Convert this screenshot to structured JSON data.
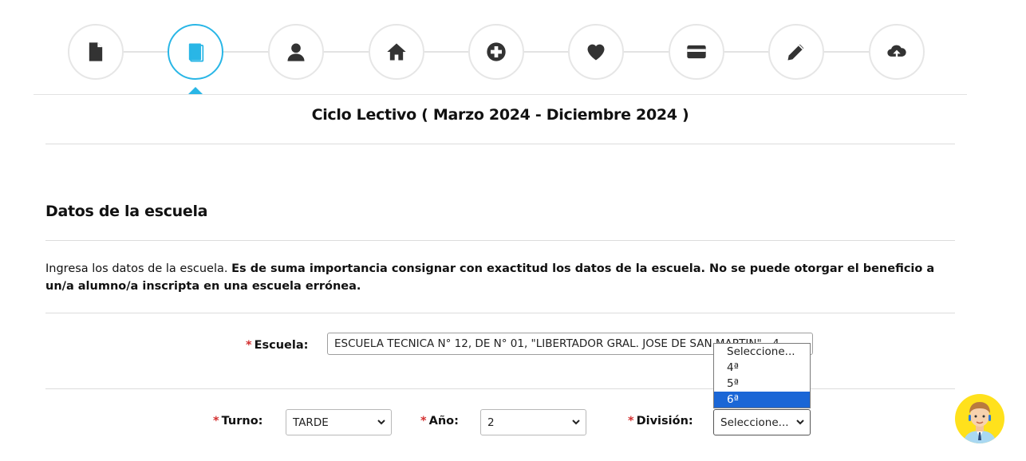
{
  "stepper": {
    "accent": "#29b6e6",
    "steps": [
      {
        "icon": "document-icon"
      },
      {
        "icon": "book-icon",
        "active": true
      },
      {
        "icon": "user-icon"
      },
      {
        "icon": "home-icon"
      },
      {
        "icon": "plus-circle-icon"
      },
      {
        "icon": "heart-icon"
      },
      {
        "icon": "credit-card-icon"
      },
      {
        "icon": "pencil-icon"
      },
      {
        "icon": "cloud-upload-icon"
      }
    ]
  },
  "header": {
    "cycle_title": "Ciclo Lectivo ( Marzo 2024 - Diciembre 2024 )"
  },
  "section": {
    "title": "Datos de la escuela",
    "intro_plain": "Ingresa los datos de la escuela. ",
    "intro_bold": "Es de suma importancia consignar con exactitud los datos de la escuela. No se puede otorgar el beneficio a un/a alumno/a inscripta en una escuela errónea."
  },
  "form": {
    "required_mark": "*",
    "escuela": {
      "label": "Escuela:",
      "value": "ESCUELA TECNICA N° 12, DE N° 01, \"LIBERTADOR GRAL. JOSE DE SAN MARTIN\" - 4"
    },
    "turno": {
      "label": "Turno:",
      "value": "TARDE"
    },
    "anio": {
      "label": "Año:",
      "value": "2"
    },
    "division": {
      "label": "División:",
      "value": "Seleccione...",
      "options": [
        "Seleccione...",
        "4ª",
        "5ª",
        "6ª"
      ],
      "highlighted": "6ª"
    }
  },
  "assistant": {
    "icon": "assistant-avatar-icon",
    "color": "#ffe11c"
  }
}
